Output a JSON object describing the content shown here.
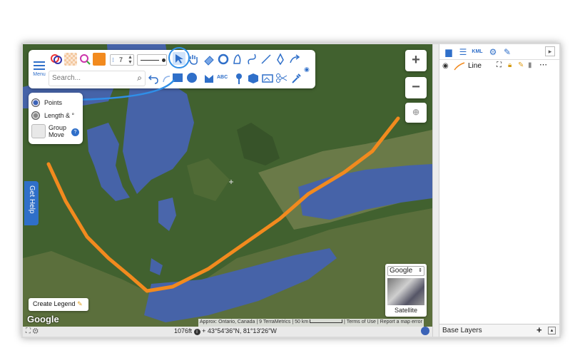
{
  "toolbar": {
    "menu_label": "Menu",
    "size_value": "7",
    "search_placeholder": "Search..."
  },
  "points_panel": {
    "points_label": "Points",
    "length_label": "Length & °",
    "group_move_label": "Group Move"
  },
  "map": {
    "zoom_in_label": "+",
    "zoom_out_label": "−",
    "get_help_label": "Get Help",
    "create_legend_label": "Create Legend",
    "google_label": "Google",
    "map_type_selected": "Google",
    "map_type_thumb_label": "Satellite",
    "attribution": {
      "approx": "Approx: Ontario, Canada",
      "terrametrics": "9 TerraMetrics",
      "scale": "50 km",
      "terms": "Terms of Use",
      "report": "Report a map error"
    },
    "line_color": "#f28a1e"
  },
  "status": {
    "scale_text": "1076ft",
    "coords_text": "+ 43°54′36″N, 81°13′26″W"
  },
  "panel": {
    "layer_name": "Line",
    "base_layers_label": "Base Layers"
  },
  "colors": {
    "accent": "#2f6fc9",
    "fill_swatch": "#f28a1e"
  }
}
